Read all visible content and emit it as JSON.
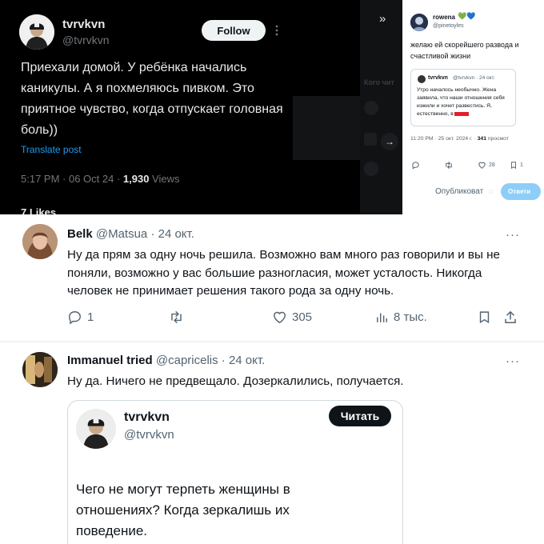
{
  "main_tweet": {
    "display_name": "tvrvkvn",
    "handle": "@tvrvkvn",
    "follow_label": "Follow",
    "text": "Приехали домой. У ребёнка начались каникулы. А я похмеляюсь пивком.  Это приятное чувство, когда отпускает головная боль))",
    "translate_label": "Translate post",
    "timestamp": "5:17 PM · 06 Oct 24 · ",
    "views_count": "1,930",
    "views_label": " Views",
    "likes": "7 Likes",
    "sidebar_text": "Кого чит",
    "colors": {
      "background": "#000000",
      "link": "#1d9bf0"
    }
  },
  "rowena_tweet": {
    "display_name": "rowena",
    "hearts": [
      "💚",
      "💙"
    ],
    "handle": "@pinetoyles",
    "text": "желаю ей скорейшего развода и счастливой жизни",
    "quote": {
      "name": "tvrvkvn",
      "handle": "@tvrvkvn · 24 окт.",
      "text": "Утро началось необычно. Жена заявила, что наши отношения себя изжили и хочет развестись. Я, естественно, в"
    },
    "timestamp": "11:20 PM · 25 окт. 2024 г. · ",
    "views_count": "341",
    "views_label": " просмот",
    "likes_count": "28",
    "bookmarks_count": "1",
    "publish_label": "Опубликоват",
    "reply_label": "Ответи"
  },
  "belk_reply": {
    "display_name": "Belk",
    "handle": "@Matsua · 24 окт.",
    "more": "···",
    "text": "Ну да прям за одну ночь решила. Возможно вам много раз говорили и вы не поняли, возможно у вас большие разногласия, может  усталость. Никогда человек не принимает решения такого рода за одну ночь.",
    "replies": "1",
    "likes": "305",
    "views": "8 тыс."
  },
  "immanuel_reply": {
    "display_name": "Immanuel tried",
    "handle": "@capricelis · 24 окт.",
    "more": "···",
    "text": "Ну да. Ничего не предвещало. Дозеркалились, получается.",
    "quote_card": {
      "name": "tvrvkvn",
      "handle": "@tvrvkvn",
      "read_label": "Читать",
      "text": "Чего не могут терпеть женщины в отношениях? Когда зеркалишь их поведение."
    }
  }
}
